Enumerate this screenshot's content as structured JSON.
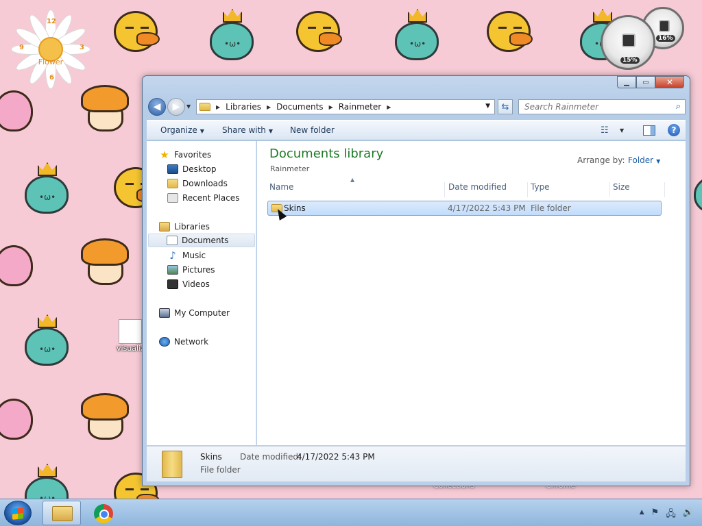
{
  "desktop": {
    "clock_gadget_label": "Flower",
    "clock_numbers": [
      "12",
      "3",
      "6",
      "9"
    ],
    "gauge_left_value": "15%",
    "gauge_right_value": "16%",
    "desktop_file_label": "visualiz",
    "bg_text_1": "Collections",
    "bg_text_2": "Chrome"
  },
  "window": {
    "caption_buttons": {
      "minimize": "▁",
      "maximize": "▭",
      "close": "✕"
    },
    "address": {
      "crumbs": [
        "Libraries",
        "Documents",
        "Rainmeter"
      ]
    },
    "search": {
      "placeholder": "Search Rainmeter"
    },
    "commands": {
      "organize": "Organize",
      "share_with": "Share with",
      "new_folder": "New folder"
    },
    "nav_pane": {
      "favorites": "Favorites",
      "desktop": "Desktop",
      "downloads": "Downloads",
      "recent_places": "Recent Places",
      "libraries": "Libraries",
      "documents": "Documents",
      "music": "Music",
      "pictures": "Pictures",
      "videos": "Videos",
      "my_computer": "My Computer",
      "network": "Network"
    },
    "content": {
      "title": "Documents library",
      "subtitle": "Rainmeter",
      "arrange_by_label": "Arrange by:",
      "arrange_by_value": "Folder",
      "columns": {
        "name": "Name",
        "date_modified": "Date modified",
        "type": "Type",
        "size": "Size"
      },
      "rows": [
        {
          "name": "Skins",
          "date_modified": "4/17/2022 5:43 PM",
          "type": "File folder",
          "size": ""
        }
      ]
    },
    "details": {
      "name": "Skins",
      "type": "File folder",
      "date_label": "Date modified:",
      "date_value": "4/17/2022 5:43 PM"
    }
  },
  "taskbar": {
    "tray": {
      "show_hidden": "▲",
      "action_center": "⚑",
      "network": "🖧",
      "volume": "🔊"
    }
  },
  "colors": {
    "library_title": "#1e7a25",
    "link_blue": "#1f5fa8",
    "wallpaper": "#f7cbd5"
  }
}
